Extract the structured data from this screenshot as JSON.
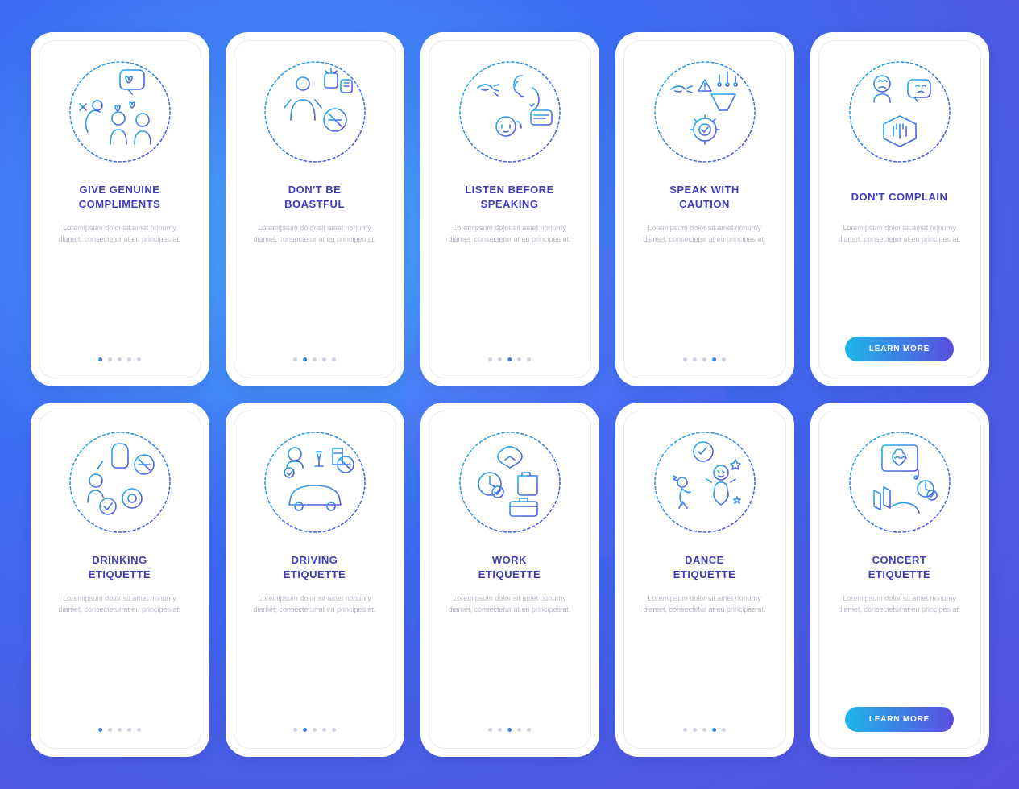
{
  "lorem": "Loremipsum dolor sit amet nonumy diamet, consectetur at eu principes at.",
  "cards": [
    {
      "title": "GIVE GENUINE\nCOMPLIMENTS",
      "activeDot": 0,
      "hasButton": false,
      "icon": "compliments"
    },
    {
      "title": "DON'T BE\nBOASTFUL",
      "activeDot": 1,
      "hasButton": false,
      "icon": "boastful"
    },
    {
      "title": "LISTEN BEFORE\nSPEAKING",
      "activeDot": 2,
      "hasButton": false,
      "icon": "listen"
    },
    {
      "title": "SPEAK WITH\nCAUTION",
      "activeDot": 3,
      "hasButton": false,
      "icon": "caution"
    },
    {
      "title": "DON'T COMPLAIN",
      "activeDot": 4,
      "hasButton": true,
      "buttonLabel": "LEARN MORE",
      "icon": "complain"
    },
    {
      "title": "DRINKING\nETIQUETTE",
      "activeDot": 0,
      "hasButton": false,
      "icon": "drinking"
    },
    {
      "title": "DRIVING\nETIQUETTE",
      "activeDot": 1,
      "hasButton": false,
      "icon": "driving"
    },
    {
      "title": "WORK\nETIQUETTE",
      "activeDot": 2,
      "hasButton": false,
      "icon": "work"
    },
    {
      "title": "DANCE\nETIQUETTE",
      "activeDot": 3,
      "hasButton": false,
      "icon": "dance"
    },
    {
      "title": "CONCERT\nETIQUETTE",
      "activeDot": 4,
      "hasButton": true,
      "buttonLabel": "LEARN MORE",
      "icon": "concert"
    }
  ],
  "colors": {
    "gradStart": "#1fb6e8",
    "gradEnd": "#5a4de0"
  }
}
